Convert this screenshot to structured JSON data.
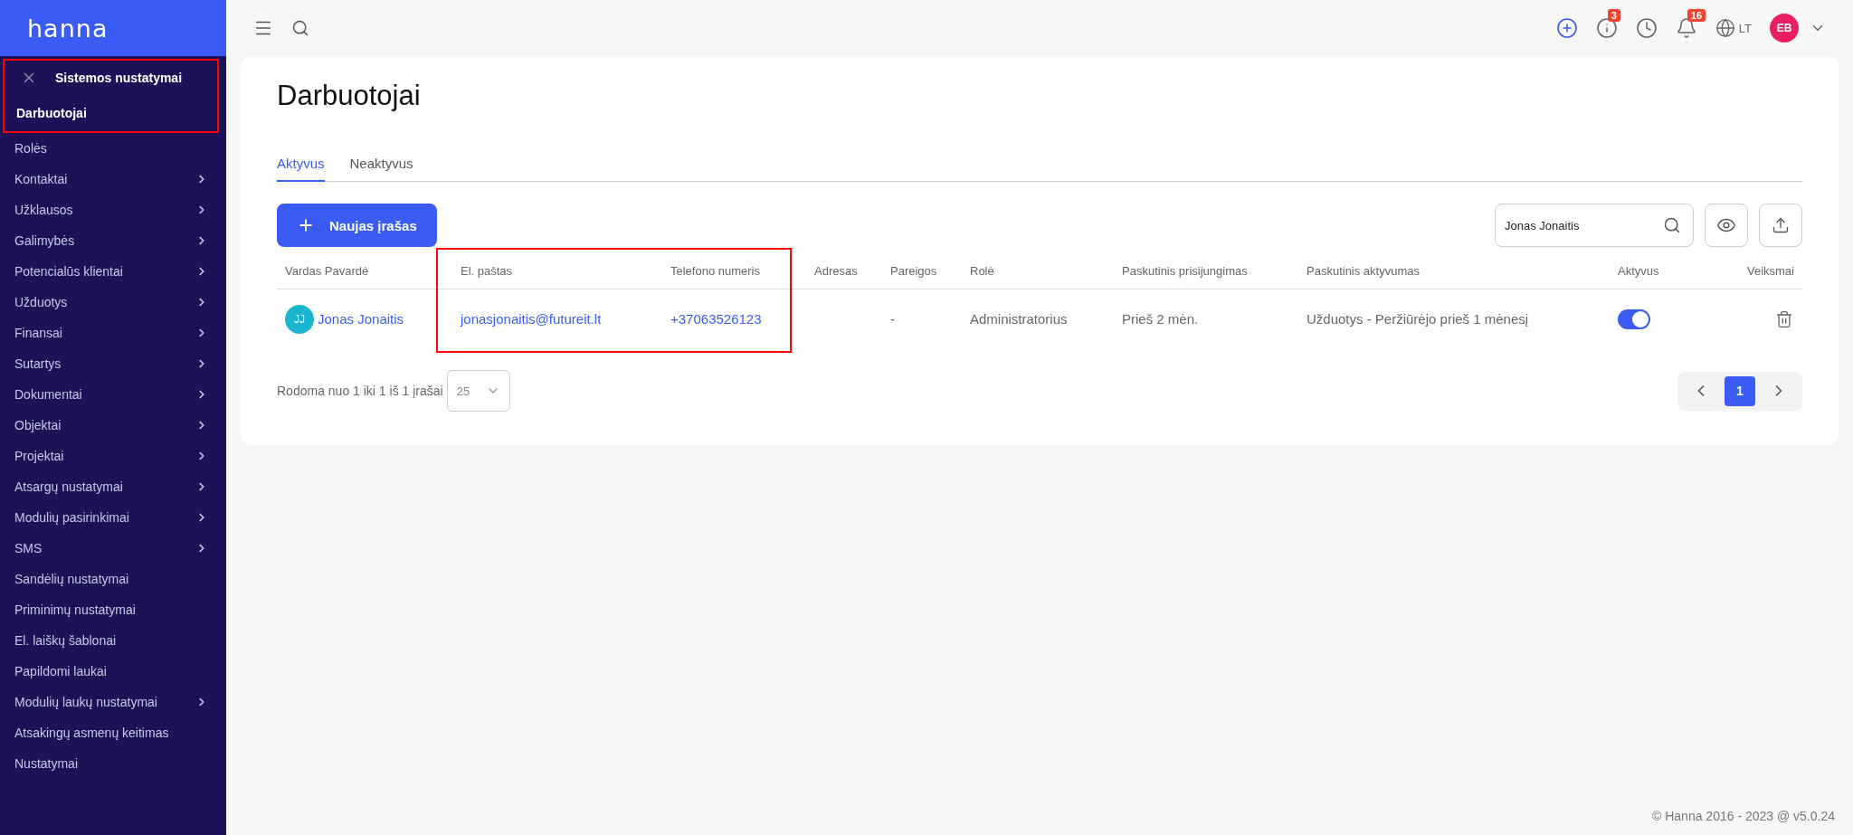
{
  "logo": "hanna",
  "sidebar": {
    "section": {
      "title": "Sistemos nustatymai",
      "highlighted": true
    },
    "items": [
      {
        "label": "Darbuotojai",
        "selected": true,
        "has_submenu": false
      },
      {
        "label": "Rolės",
        "selected": false,
        "has_submenu": false
      },
      {
        "label": "Kontaktai",
        "selected": false,
        "has_submenu": true
      },
      {
        "label": "Užklausos",
        "selected": false,
        "has_submenu": true
      },
      {
        "label": "Galimybės",
        "selected": false,
        "has_submenu": true
      },
      {
        "label": "Potencialūs klientai",
        "selected": false,
        "has_submenu": true
      },
      {
        "label": "Užduotys",
        "selected": false,
        "has_submenu": true
      },
      {
        "label": "Finansai",
        "selected": false,
        "has_submenu": true
      },
      {
        "label": "Sutartys",
        "selected": false,
        "has_submenu": true
      },
      {
        "label": "Dokumentai",
        "selected": false,
        "has_submenu": true
      },
      {
        "label": "Objektai",
        "selected": false,
        "has_submenu": true
      },
      {
        "label": "Projektai",
        "selected": false,
        "has_submenu": true
      },
      {
        "label": "Atsargų nustatymai",
        "selected": false,
        "has_submenu": true
      },
      {
        "label": "Modulių pasirinkimai",
        "selected": false,
        "has_submenu": true
      },
      {
        "label": "SMS",
        "selected": false,
        "has_submenu": true
      },
      {
        "label": "Sandėlių nustatymai",
        "selected": false,
        "has_submenu": false
      },
      {
        "label": "Priminimų nustatymai",
        "selected": false,
        "has_submenu": false
      },
      {
        "label": "El. laiškų šablonai",
        "selected": false,
        "has_submenu": false
      },
      {
        "label": "Papildomi laukai",
        "selected": false,
        "has_submenu": false
      },
      {
        "label": "Modulių laukų nustatymai",
        "selected": false,
        "has_submenu": true
      },
      {
        "label": "Atsakingų asmenų keitimas",
        "selected": false,
        "has_submenu": false
      },
      {
        "label": "Nustatymai",
        "selected": false,
        "has_submenu": false
      }
    ]
  },
  "topbar": {
    "actions": [
      {
        "kind": "add"
      },
      {
        "kind": "info",
        "badge": "3"
      },
      {
        "kind": "history"
      },
      {
        "kind": "notifications",
        "badge": "16"
      }
    ],
    "language": "LT",
    "user": {
      "initials": "EB"
    }
  },
  "page": {
    "title": "Darbuotojai",
    "tabs": [
      {
        "label": "Aktyvus",
        "selected": true
      },
      {
        "label": "Neaktyvus",
        "selected": false
      }
    ],
    "new_button": "Naujas įrašas",
    "search": {
      "value": "Jonas Jonaitis"
    }
  },
  "table": {
    "contact_columns_highlighted": true,
    "columns": [
      {
        "label": "Vardas Pavardė"
      },
      {
        "label": "El. paštas"
      },
      {
        "label": "Telefono numeris"
      },
      {
        "label": "Adresas"
      },
      {
        "label": "Pareigos"
      },
      {
        "label": "Rolė"
      },
      {
        "label": "Paskutinis prisijungimas"
      },
      {
        "label": "Paskutinis aktyvumas"
      },
      {
        "label": "Aktyvus"
      },
      {
        "label": "Veiksmai"
      }
    ],
    "rows": [
      {
        "cells": [
          {
            "kind": "person",
            "initials": "JJ",
            "text": "Jonas Jonaitis"
          },
          {
            "kind": "link",
            "text": "jonasjonaitis@futureit.lt"
          },
          {
            "kind": "link",
            "text": "+37063526123"
          },
          {
            "kind": "empty"
          },
          {
            "kind": "text",
            "text": "-"
          },
          {
            "kind": "text",
            "text": "Administratorius"
          },
          {
            "kind": "text",
            "text": "Prieš 2 mėn."
          },
          {
            "kind": "text",
            "text": "Užduotys - Peržiūrėjo prieš 1 mėnesį"
          },
          {
            "kind": "toggle",
            "on": true
          },
          {
            "kind": "delete"
          }
        ]
      }
    ]
  },
  "pagination": {
    "summary": "Rodoma nuo 1 iki 1 iš 1 įrašai",
    "page_size": "25",
    "pages": [
      {
        "label": "1",
        "selected": true
      }
    ]
  },
  "footer": "© Hanna 2016 - 2023 @ v5.0.24"
}
